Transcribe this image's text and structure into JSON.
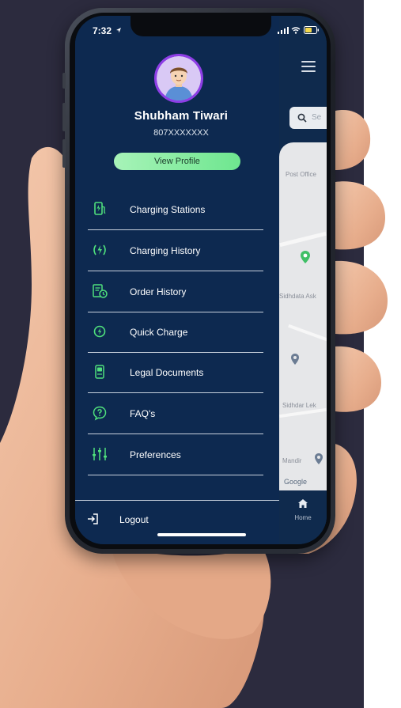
{
  "status_bar": {
    "time": "7:32"
  },
  "profile": {
    "name": "Shubham Tiwari",
    "phone": "807XXXXXXX",
    "view_profile_label": "View Profile"
  },
  "menu": {
    "items": [
      {
        "label": "Charging Stations",
        "icon": "ev-station-icon"
      },
      {
        "label": "Charging History",
        "icon": "charging-history-icon"
      },
      {
        "label": "Order History",
        "icon": "order-history-icon"
      },
      {
        "label": "Quick Charge",
        "icon": "quick-charge-icon"
      },
      {
        "label": "Legal Documents",
        "icon": "legal-document-icon"
      },
      {
        "label": "FAQ's",
        "icon": "faq-icon"
      },
      {
        "label": "Preferences",
        "icon": "preferences-sliders-icon"
      }
    ],
    "logout_label": "Logout"
  },
  "map": {
    "search_placeholder": "Se",
    "labels": [
      "Post Office",
      "Sidhdata Ask",
      "Sidhdar Lek",
      "Mandir",
      "Google"
    ],
    "home_label": "Home"
  },
  "colors": {
    "drawer_bg": "#0d2950",
    "accent_green": "#6ee68f",
    "icon_green": "#4fe07c",
    "avatar_purple": "#7b2fd0",
    "page_bg": "#2c2b3e"
  }
}
